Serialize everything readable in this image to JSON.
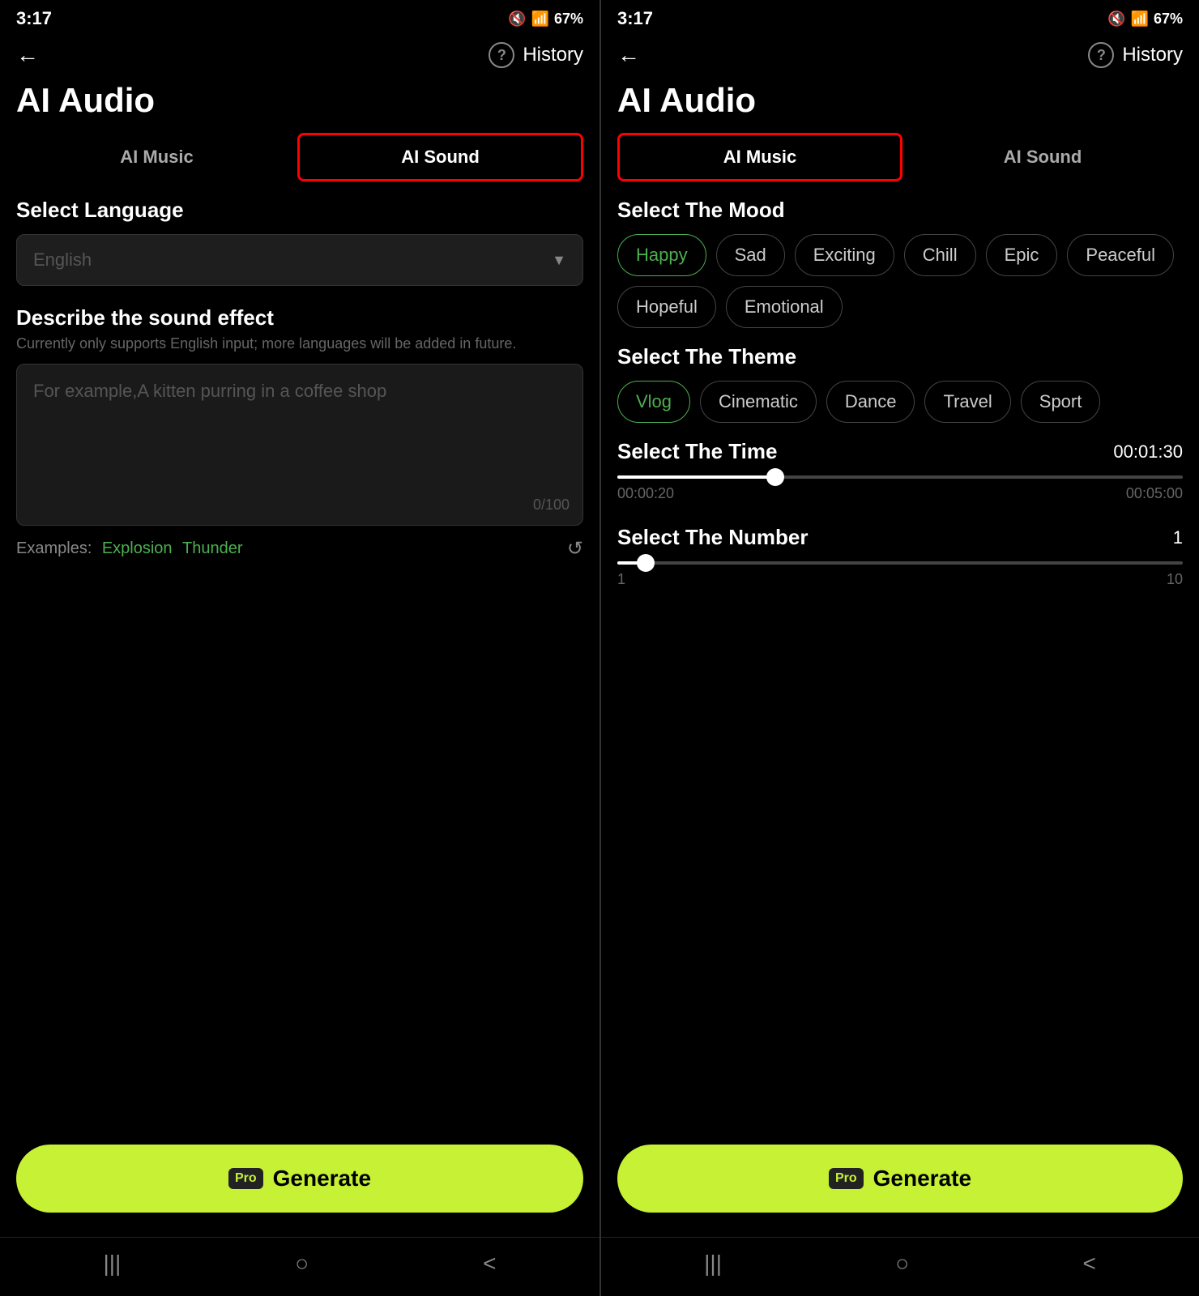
{
  "left_panel": {
    "status": {
      "time": "3:17",
      "battery": "67%"
    },
    "top": {
      "history": "History"
    },
    "title": "AI Audio",
    "tabs": [
      {
        "id": "ai-music",
        "label": "AI Music",
        "active": false
      },
      {
        "id": "ai-sound",
        "label": "AI Sound",
        "active": true
      }
    ],
    "language_section": {
      "label": "Select Language",
      "placeholder": "English"
    },
    "describe_section": {
      "title": "Describe the sound effect",
      "subtitle": "Currently only supports English input; more languages will be added in future.",
      "placeholder": "For example,A kitten purring in a coffee shop",
      "counter": "0/100"
    },
    "examples": {
      "label": "Examples:",
      "items": [
        "Explosion",
        "Thunder"
      ]
    },
    "generate_btn": {
      "pro_label": "Pro",
      "label": "Generate"
    }
  },
  "right_panel": {
    "status": {
      "time": "3:17",
      "battery": "67%"
    },
    "top": {
      "history": "History"
    },
    "title": "AI Audio",
    "tabs": [
      {
        "id": "ai-music",
        "label": "AI Music",
        "active": true
      },
      {
        "id": "ai-sound",
        "label": "AI Sound",
        "active": false
      }
    ],
    "mood_section": {
      "label": "Select The Mood",
      "options": [
        {
          "label": "Happy",
          "selected": true
        },
        {
          "label": "Sad",
          "selected": false
        },
        {
          "label": "Exciting",
          "selected": false
        },
        {
          "label": "Chill",
          "selected": false
        },
        {
          "label": "Epic",
          "selected": false
        },
        {
          "label": "Peaceful",
          "selected": false
        },
        {
          "label": "Hopeful",
          "selected": false
        },
        {
          "label": "Emotional",
          "selected": false
        }
      ]
    },
    "theme_section": {
      "label": "Select The Theme",
      "options": [
        {
          "label": "Vlog",
          "selected": true
        },
        {
          "label": "Cinematic",
          "selected": false
        },
        {
          "label": "Dance",
          "selected": false
        },
        {
          "label": "Travel",
          "selected": false
        },
        {
          "label": "Sport",
          "selected": false
        }
      ]
    },
    "time_section": {
      "label": "Select The Time",
      "value": "00:01:30",
      "min": "00:00:20",
      "max": "00:05:00",
      "fill_percent": 28
    },
    "number_section": {
      "label": "Select The Number",
      "value": "1",
      "min": "1",
      "max": "10",
      "fill_percent": 5
    },
    "generate_btn": {
      "pro_label": "Pro",
      "label": "Generate"
    }
  },
  "nav": {
    "menu_icon": "|||",
    "home_icon": "○",
    "back_icon": "<"
  }
}
